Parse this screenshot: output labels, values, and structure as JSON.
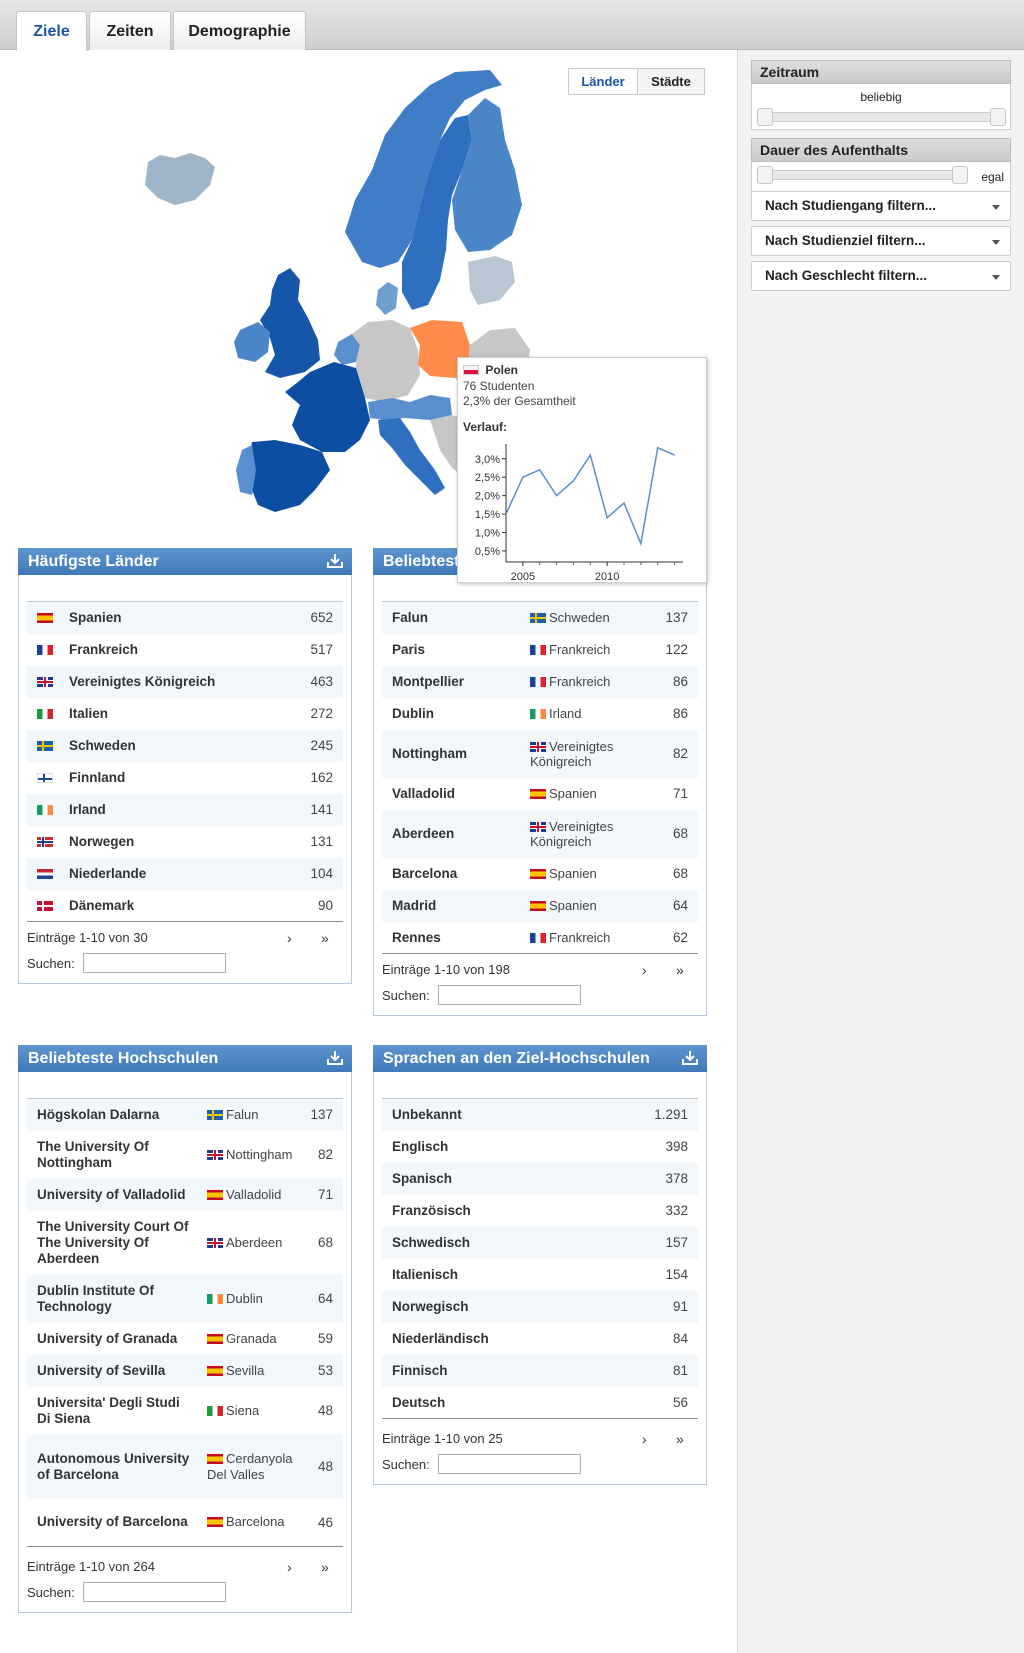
{
  "tabs": [
    {
      "label": "Ziele",
      "active": true
    },
    {
      "label": "Zeiten",
      "active": false
    },
    {
      "label": "Demographie",
      "active": false
    }
  ],
  "map_toggle": {
    "laender": "Länder",
    "staedte": "Städte",
    "active": "Länder"
  },
  "colors": {
    "accent": "#1a56a8",
    "panel_header": "#4a84c4",
    "highlight_country": "#ff8c4a",
    "map_dark_blue": "#0b4ea2",
    "map_mid_blue": "#3f7ec7",
    "map_light_blue": "#6f9fcf",
    "map_pale": "#9fb5c8",
    "map_gray": "#c7c7c7"
  },
  "sidebar": {
    "zeitraum": {
      "title": "Zeitraum",
      "value": "beliebig"
    },
    "dauer": {
      "title": "Dauer des Aufenthalts",
      "value": "egal"
    },
    "filters": [
      "Nach Studiengang filtern...",
      "Nach Studienziel filtern...",
      "Nach Geschlecht filtern..."
    ]
  },
  "tooltip": {
    "country": "Polen",
    "students": "76 Studenten",
    "share": "2,3% der Gesamtheit",
    "history_label": "Verlauf:",
    "y_ticks": [
      "3,0%",
      "2,5%",
      "2,0%",
      "1,5%",
      "1,0%",
      "0,5%"
    ],
    "x_ticks": [
      "2005",
      "2010"
    ]
  },
  "chart_data": {
    "type": "line",
    "title": "",
    "xlabel": "",
    "ylabel": "",
    "x": [
      2004,
      2005,
      2006,
      2007,
      2008,
      2009,
      2010,
      2011,
      2012,
      2013,
      2014
    ],
    "values": [
      1.5,
      2.5,
      2.7,
      2.0,
      2.4,
      3.1,
      1.4,
      1.8,
      0.7,
      3.3,
      3.1
    ],
    "ylim": [
      0.2,
      3.4
    ],
    "xlim": [
      2004,
      2014.5
    ],
    "unit": "%",
    "grid": false
  },
  "countries_panel": {
    "title": "Häufigste Länder",
    "rows": [
      {
        "flag": "es",
        "name": "Spanien",
        "count": "652"
      },
      {
        "flag": "fr",
        "name": "Frankreich",
        "count": "517"
      },
      {
        "flag": "gb",
        "name": "Vereinigtes Königreich",
        "count": "463"
      },
      {
        "flag": "it",
        "name": "Italien",
        "count": "272"
      },
      {
        "flag": "se",
        "name": "Schweden",
        "count": "245"
      },
      {
        "flag": "fi",
        "name": "Finnland",
        "count": "162"
      },
      {
        "flag": "ie",
        "name": "Irland",
        "count": "141"
      },
      {
        "flag": "no",
        "name": "Norwegen",
        "count": "131"
      },
      {
        "flag": "nl",
        "name": "Niederlande",
        "count": "104"
      },
      {
        "flag": "dk",
        "name": "Dänemark",
        "count": "90"
      }
    ],
    "pager": "Einträge 1-10 von 30",
    "search_label": "Suchen:"
  },
  "cities_panel": {
    "title": "Beliebteste Städte",
    "rows": [
      {
        "city": "Falun",
        "flag": "se",
        "country": "Schweden",
        "count": "137"
      },
      {
        "city": "Paris",
        "flag": "fr",
        "country": "Frankreich",
        "count": "122"
      },
      {
        "city": "Montpellier",
        "flag": "fr",
        "country": "Frankreich",
        "count": "86"
      },
      {
        "city": "Dublin",
        "flag": "ie",
        "country": "Irland",
        "count": "86"
      },
      {
        "city": "Nottingham",
        "flag": "gb",
        "country": "Vereinigtes Königreich",
        "count": "82"
      },
      {
        "city": "Valladolid",
        "flag": "es",
        "country": "Spanien",
        "count": "71"
      },
      {
        "city": "Aberdeen",
        "flag": "gb",
        "country": "Vereinigtes Königreich",
        "count": "68"
      },
      {
        "city": "Barcelona",
        "flag": "es",
        "country": "Spanien",
        "count": "68"
      },
      {
        "city": "Madrid",
        "flag": "es",
        "country": "Spanien",
        "count": "64"
      },
      {
        "city": "Rennes",
        "flag": "fr",
        "country": "Frankreich",
        "count": "62"
      }
    ],
    "pager": "Einträge 1-10 von 198",
    "search_label": "Suchen:"
  },
  "universities_panel": {
    "title": "Beliebteste Hochschulen",
    "rows": [
      {
        "name": "Högskolan Dalarna",
        "flag": "se",
        "city": "Falun",
        "count": "137"
      },
      {
        "name": "The University Of Nottingham",
        "flag": "gb",
        "city": "Nottingham",
        "count": "82"
      },
      {
        "name": "University of Valladolid",
        "flag": "es",
        "city": "Valladolid",
        "count": "71"
      },
      {
        "name": "The University Court Of The University Of Aberdeen",
        "flag": "gb",
        "city": "Aberdeen",
        "count": "68"
      },
      {
        "name": "Dublin Institute Of Technology",
        "flag": "ie",
        "city": "Dublin",
        "count": "64"
      },
      {
        "name": "University of Granada",
        "flag": "es",
        "city": "Granada",
        "count": "59"
      },
      {
        "name": "University of Sevilla",
        "flag": "es",
        "city": "Sevilla",
        "count": "53"
      },
      {
        "name": "Universita' Degli Studi Di Siena",
        "flag": "it",
        "city": "Siena",
        "count": "48"
      },
      {
        "name": "Autonomous University of Barcelona",
        "flag": "es",
        "city": "Cerdanyola Del Valles",
        "count": "48"
      },
      {
        "name": "University of Barcelona",
        "flag": "es",
        "city": "Barcelona",
        "count": "46"
      }
    ],
    "pager": "Einträge 1-10 von 264",
    "search_label": "Suchen:"
  },
  "languages_panel": {
    "title": "Sprachen an den Ziel-Hochschulen",
    "rows": [
      {
        "name": "Unbekannt",
        "count": "1.291"
      },
      {
        "name": "Englisch",
        "count": "398"
      },
      {
        "name": "Spanisch",
        "count": "378"
      },
      {
        "name": "Französisch",
        "count": "332"
      },
      {
        "name": "Schwedisch",
        "count": "157"
      },
      {
        "name": "Italienisch",
        "count": "154"
      },
      {
        "name": "Norwegisch",
        "count": "91"
      },
      {
        "name": "Niederländisch",
        "count": "84"
      },
      {
        "name": "Finnisch",
        "count": "81"
      },
      {
        "name": "Deutsch",
        "count": "56"
      }
    ],
    "pager": "Einträge 1-10 von 25",
    "search_label": "Suchen:"
  },
  "pager_arrows": {
    "next": "›",
    "last": "»"
  }
}
